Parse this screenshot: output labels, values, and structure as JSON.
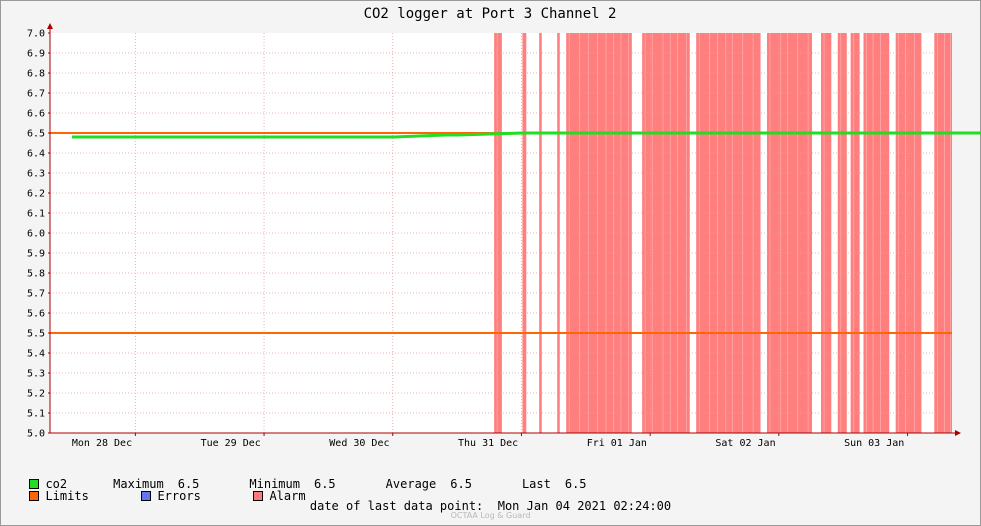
{
  "chart_data": {
    "type": "line",
    "title": "CO2 logger at Port 3 Channel 2",
    "ylim": [
      5.0,
      7.0
    ],
    "y_ticks": [
      "5.0",
      "5.1",
      "5.2",
      "5.3",
      "5.4",
      "5.5",
      "5.6",
      "5.7",
      "5.8",
      "5.9",
      "6.0",
      "6.1",
      "6.2",
      "6.3",
      "6.4",
      "6.5",
      "6.6",
      "6.7",
      "6.8",
      "6.9",
      "7.0"
    ],
    "x_ticks": [
      "Mon 28 Dec",
      "Tue 29 Dec",
      "Wed 30 Dec",
      "Thu 31 Dec",
      "Fri 01 Jan",
      "Sat 02 Jan",
      "Sun 03 Jan"
    ],
    "xlim_days": [
      0,
      7.23
    ],
    "limits": [
      5.5,
      6.5
    ],
    "series": [
      {
        "name": "co2",
        "x_days": [
          0.0,
          0.5,
          1.0,
          1.5,
          2.0,
          2.5,
          2.9,
          3.0,
          3.5,
          4.0,
          4.5,
          5.0,
          5.5,
          6.0,
          6.5,
          7.0,
          7.23
        ],
        "values": [
          6.48,
          6.48,
          6.48,
          6.48,
          6.48,
          6.48,
          6.49,
          6.49,
          6.5,
          6.5,
          6.5,
          6.5,
          6.5,
          6.5,
          6.5,
          6.5,
          6.5
        ]
      }
    ],
    "alarm_intervals_days": [
      [
        3.28,
        3.34
      ],
      [
        3.5,
        3.53
      ],
      [
        3.63,
        3.65
      ],
      [
        3.77,
        3.79
      ],
      [
        3.84,
        4.35
      ],
      [
        4.43,
        4.8
      ],
      [
        4.85,
        5.35
      ],
      [
        5.4,
        5.75
      ],
      [
        5.82,
        5.9
      ],
      [
        5.95,
        6.02
      ],
      [
        6.05,
        6.12
      ],
      [
        6.15,
        6.35
      ],
      [
        6.4,
        6.6
      ],
      [
        6.7,
        7.23
      ]
    ],
    "colors": {
      "co2": "#22dd22",
      "limits": "#ff6600",
      "errors": "#6677ee",
      "alarm": "#ff7777",
      "grid": "#e8a0a0",
      "axis": "#aa0000"
    }
  },
  "legend": {
    "co2_label": "co2",
    "max_label": "Maximum",
    "max_value": "6.5",
    "min_label": "Minimum",
    "min_value": "6.5",
    "avg_label": "Average",
    "avg_value": "6.5",
    "last_label": "Last",
    "last_value": "6.5",
    "limits_label": "Limits",
    "errors_label": "Errors",
    "alarm_label": "Alarm"
  },
  "footer": {
    "last_data_label": "date of last data point:",
    "last_data_value": "Mon Jan 04 2021 02:24:00",
    "watermark": "OCTAA Log & Guard"
  }
}
